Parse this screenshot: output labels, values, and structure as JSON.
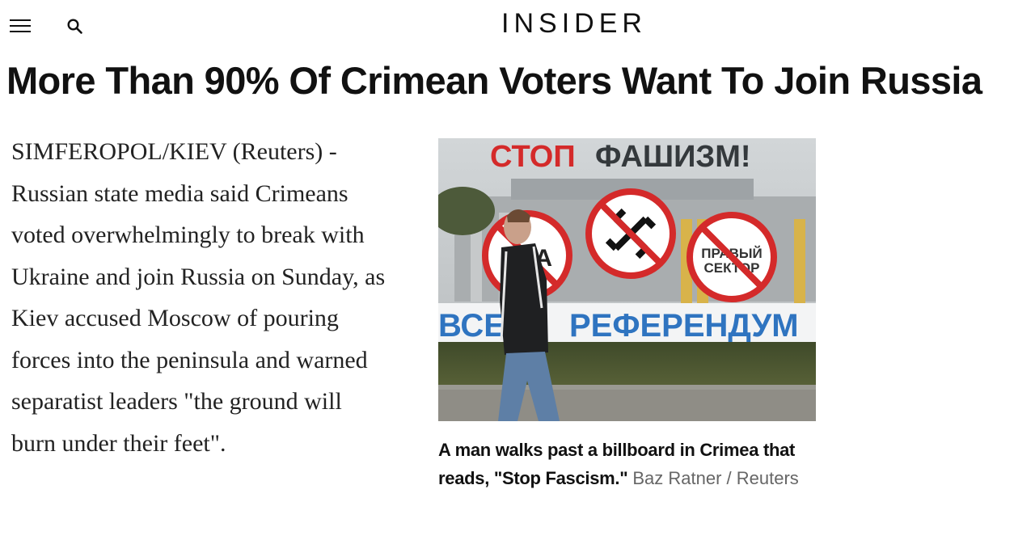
{
  "header": {
    "logo": "INSIDER",
    "menu_icon": "hamburger-menu-icon",
    "search_icon": "search-icon"
  },
  "article": {
    "headline": "More Than 90% Of Crimean Voters Want To Join Russia",
    "body": "SIMFEROPOL/KIEV (Reuters) - Russian state media said Crimeans voted overwhelmingly to break with Ukraine and join Russia on Sunday, as Kiev accused Moscow of pouring forces into the peninsula and warned separatist leaders \"the ground will burn under their feet\"."
  },
  "figure": {
    "billboard_top": "СТОП ФАШИЗМ!",
    "billboard_top_red": "СТОП",
    "billboard_top_dark": "ФАШИЗМ!",
    "billboard_bottom_left": "ВСЕ",
    "billboard_bottom_right": "РЕФЕРЕНДУМ",
    "sign_left": "УНА",
    "sign_right": "ПРАВЫЙ СЕКТОР",
    "caption": "A man walks past a billboard in Crimea that reads, \"Stop Fascism.\"",
    "credit": "Baz Ratner / Reuters"
  },
  "colors": {
    "accent_red": "#d42a2a",
    "billboard_blue": "#2f74c0",
    "text": "#111111"
  }
}
